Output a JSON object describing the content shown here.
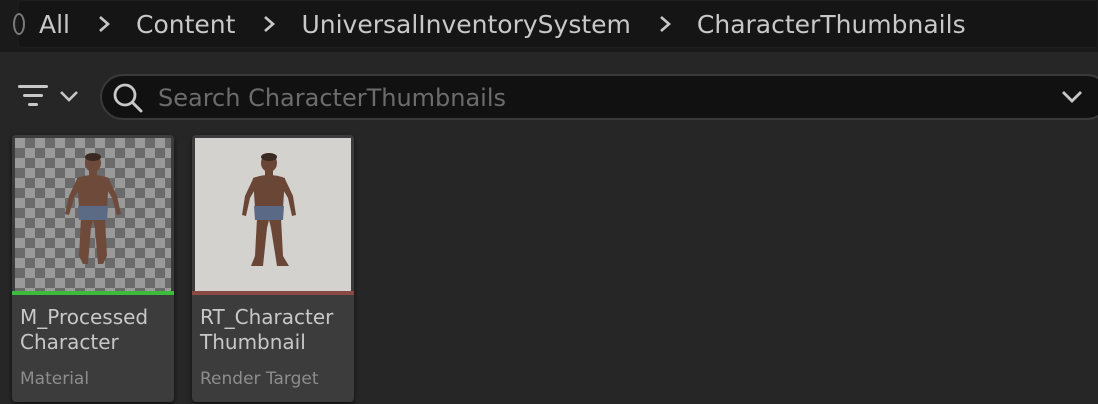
{
  "breadcrumb": {
    "items": [
      "All",
      "Content",
      "UniversalInventorySystem",
      "CharacterThumbnails"
    ]
  },
  "search": {
    "placeholder": "Search CharacterThumbnails",
    "value": ""
  },
  "icons": {
    "filter": "filter-icon",
    "search": "search-icon",
    "dropdown": "chevron-down-icon",
    "separator": "chevron-right-icon"
  },
  "assets": [
    {
      "name_line1": "M_Processed",
      "name_line2": "Character",
      "type": "Material",
      "type_color": "#3dbb3d",
      "thumbnail": "checkerboard"
    },
    {
      "name_line1": "RT_Character",
      "name_line2": "Thumbnail",
      "type": "Render Target",
      "type_color": "#8a4a44",
      "thumbnail": "plain"
    }
  ],
  "colors": {
    "background": "#262626",
    "breadcrumb_bar": "#151515",
    "search_field": "#111111",
    "tile": "#3c3c3c"
  }
}
